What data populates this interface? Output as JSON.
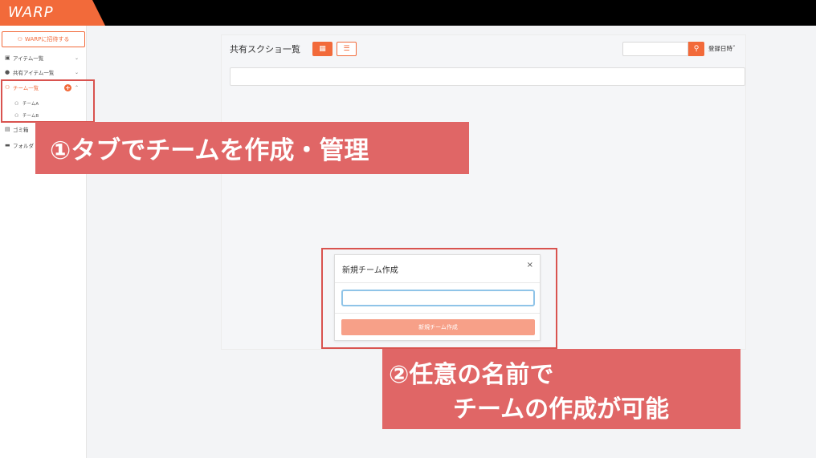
{
  "app": {
    "logo": "WARP"
  },
  "sidebar": {
    "invite_label": "WARPに招待する",
    "items": [
      {
        "label": "アイテム一覧",
        "icon": "items-icon"
      },
      {
        "label": "共有アイテム一覧",
        "icon": "shared-user-icon"
      },
      {
        "label": "チーム一覧",
        "icon": "team-icon"
      },
      {
        "label": "ゴミ箱",
        "icon": "trash-icon"
      },
      {
        "label": "フォルダ",
        "icon": "folder-icon"
      }
    ],
    "teams": [
      {
        "label": "チームA"
      },
      {
        "label": "チームB"
      }
    ]
  },
  "main": {
    "title": "共有スクショ一覧",
    "search": {
      "value": "",
      "placeholder": ""
    },
    "sort_label": "登録日時"
  },
  "modal": {
    "title": "新規チーム作成",
    "input_value": "",
    "submit_label": "新規チーム作成"
  },
  "callouts": {
    "first": "①タブでチームを作成・管理",
    "second_line1": "②任意の名前で",
    "second_line2": "チームの作成が可能"
  },
  "colors": {
    "accent": "#f26a3a",
    "callout": "#e06666",
    "highlight": "#d9534f"
  }
}
